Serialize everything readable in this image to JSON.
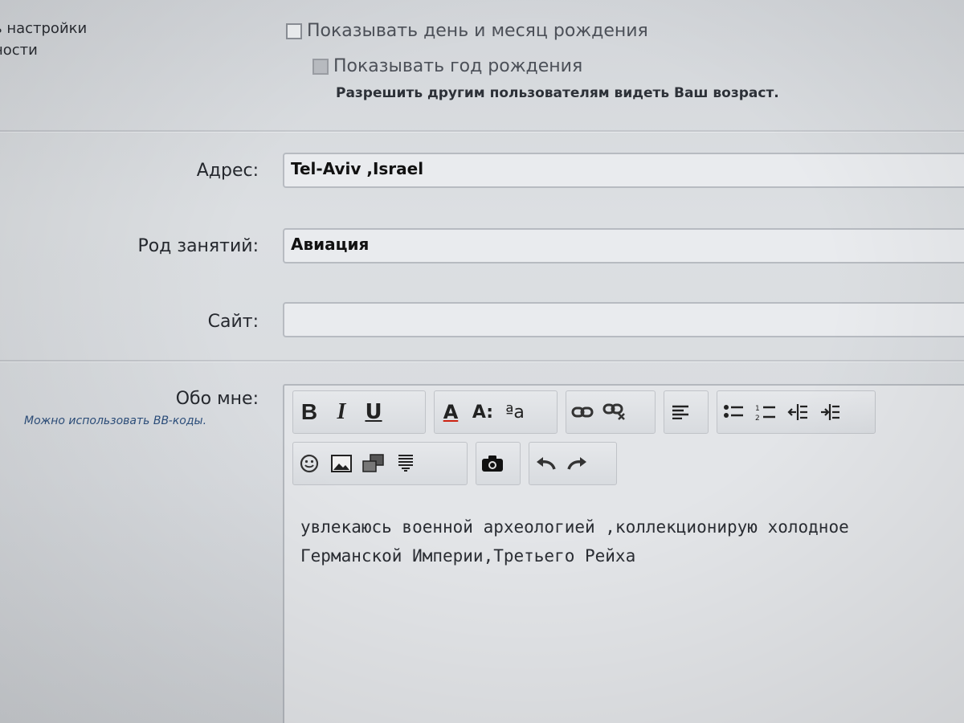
{
  "privacy": {
    "left_line1": "ь настройки",
    "left_line2": "ности",
    "show_day_month": "Показывать день и месяц рождения",
    "show_year": "Показывать год рождения",
    "hint": "Разрешить другим пользователям видеть Ваш возраст."
  },
  "form": {
    "address_label": "Адрес:",
    "address_value": "Tel-Aviv ,Israel",
    "occupation_label": "Род занятий:",
    "occupation_value": "Авиация",
    "site_label": "Сайт:",
    "site_value": "",
    "about_label": "Обо мне:",
    "bb_hint": "Можно использовать BB-коды."
  },
  "editor": {
    "toolbar": {
      "bold": "B",
      "italic": "I",
      "underline": "U",
      "font_color": "A",
      "font_size": "A:",
      "sub_sup": "ªa"
    },
    "text_line1": "увлекаюсь военной археологией ,коллекционирую холодное",
    "text_line2": "Германской Империи,Третьего Рейха"
  },
  "icons": [
    "bold-icon",
    "italic-icon",
    "underline-icon",
    "font-color-icon",
    "font-size-icon",
    "subscript-icon",
    "link-icon",
    "unlink-icon",
    "align-left-icon",
    "bullet-list-icon",
    "numbered-list-icon",
    "outdent-icon",
    "indent-icon",
    "smiley-icon",
    "image-icon",
    "gallery-icon",
    "spoiler-icon",
    "camera-icon",
    "undo-icon",
    "redo-icon"
  ]
}
